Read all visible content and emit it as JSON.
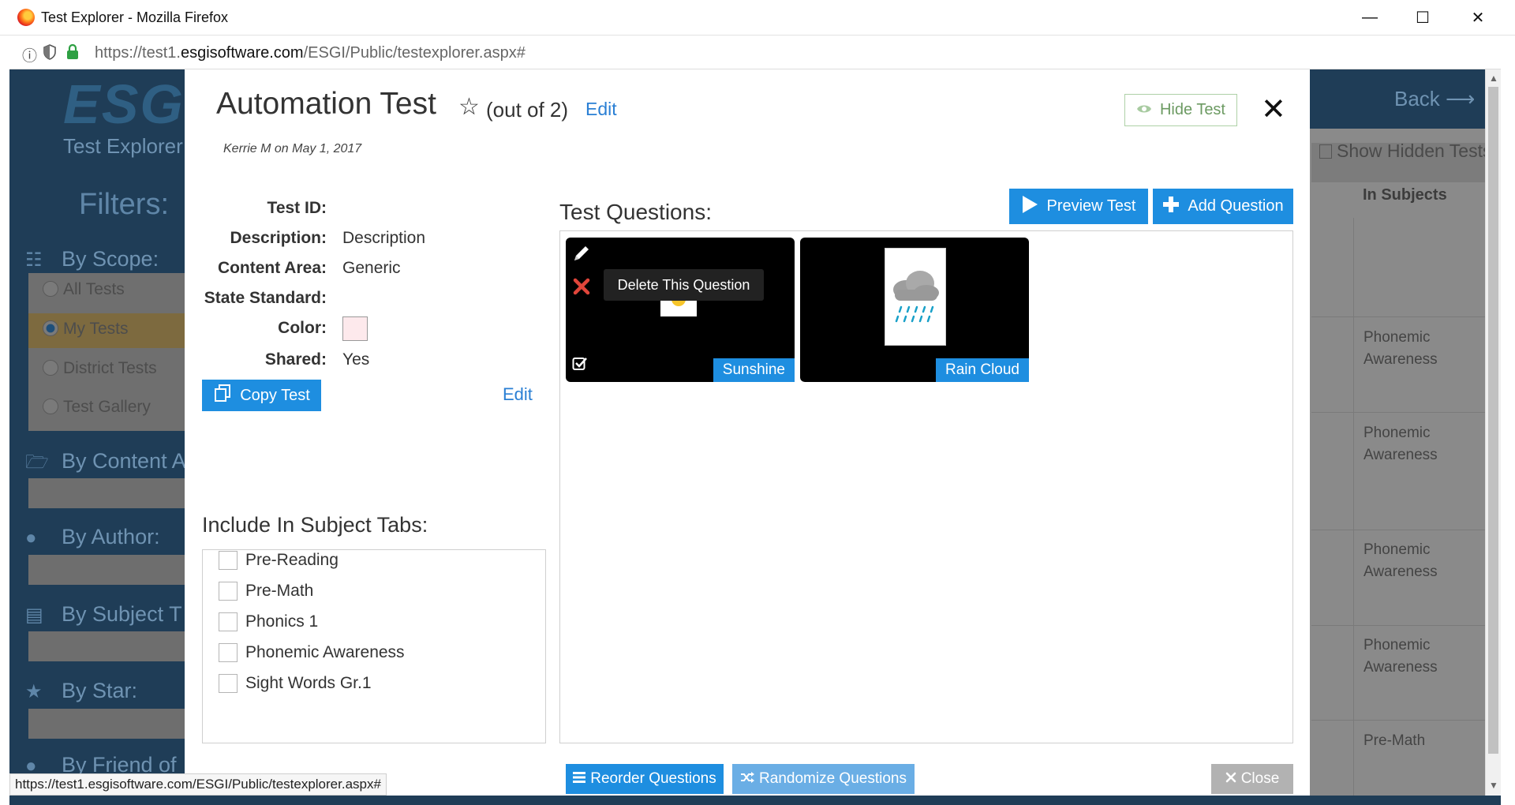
{
  "window": {
    "title": "Test Explorer - Mozilla Firefox",
    "minimize_icon": "minimize-icon",
    "maximize_icon": "maximize-icon",
    "close_icon": "close-icon"
  },
  "urlbar": {
    "url_prefix": "https://test1.",
    "url_domain": "esgisoftware.com",
    "url_path": "/ESGI/Public/testexplorer.aspx#",
    "icons": [
      "info-icon",
      "shield-icon",
      "lock-icon"
    ]
  },
  "background_app": {
    "logo": "ESGI",
    "subtitle": "Test Explorer",
    "filters_title": "Filters:",
    "filter_heads": [
      {
        "label": "By Scope:",
        "icon": "sitemap-icon"
      },
      {
        "label": "By Content A",
        "icon": "folder-icon"
      },
      {
        "label": "By Author:",
        "icon": "user-icon"
      },
      {
        "label": "By Subject T",
        "icon": "book-icon"
      },
      {
        "label": "By Star:",
        "icon": "star-icon"
      },
      {
        "label": "By Friend of",
        "icon": "users-icon"
      }
    ],
    "scope_options": [
      "All Tests",
      "My Tests",
      "District Tests",
      "Test Gallery"
    ],
    "back_label": "Back ⟶",
    "show_hidden_label": "Show Hidden Tests",
    "column_header": "In Subjects",
    "subject_cells": [
      "Phonemic Awareness",
      "Phonemic Awareness",
      "Phonemic Awareness",
      "Phonemic Awareness",
      "Pre-Math"
    ]
  },
  "modal": {
    "title": "Automation Test",
    "out_of": "(out of 2)",
    "edit_label": "Edit",
    "author_line": "Kerrie M on May 1, 2017",
    "hide_test_label": "Hide Test",
    "close_glyph": "✕",
    "properties": [
      {
        "label": "Test ID:",
        "value": ""
      },
      {
        "label": "Description:",
        "value": "Description"
      },
      {
        "label": "Content Area:",
        "value": "Generic"
      },
      {
        "label": "State Standard:",
        "value": ""
      },
      {
        "label": "Color:",
        "value": ""
      },
      {
        "label": "Shared:",
        "value": "Yes"
      }
    ],
    "color_value": "#fde9ec",
    "copy_test_label": "Copy Test",
    "edit_props_label": "Edit",
    "test_questions_title": "Test Questions:",
    "preview_test_label": "Preview Test",
    "add_question_label": "Add Question",
    "questions": [
      {
        "label": "Sunshine",
        "image": "sun-image"
      },
      {
        "label": "Rain Cloud",
        "image": "rain-cloud-image"
      }
    ],
    "tooltip": "Delete This Question",
    "subject_tabs_title": "Include In Subject Tabs:",
    "subject_tabs": [
      "Pre-Reading",
      "Pre-Math",
      "Phonics 1",
      "Phonemic Awareness",
      "Sight Words Gr.1"
    ],
    "reorder_label": "Reorder Questions",
    "randomize_label": "Randomize Questions",
    "close_label": "Close"
  },
  "status_bar": {
    "url": "https://test1.esgisoftware.com/ESGI/Public/testexplorer.aspx#"
  },
  "colors": {
    "primary_blue": "#1e8ee0",
    "link_blue": "#2a7fd4",
    "hide_green": "#6c9a62",
    "header_navy": "#1f3d57"
  }
}
